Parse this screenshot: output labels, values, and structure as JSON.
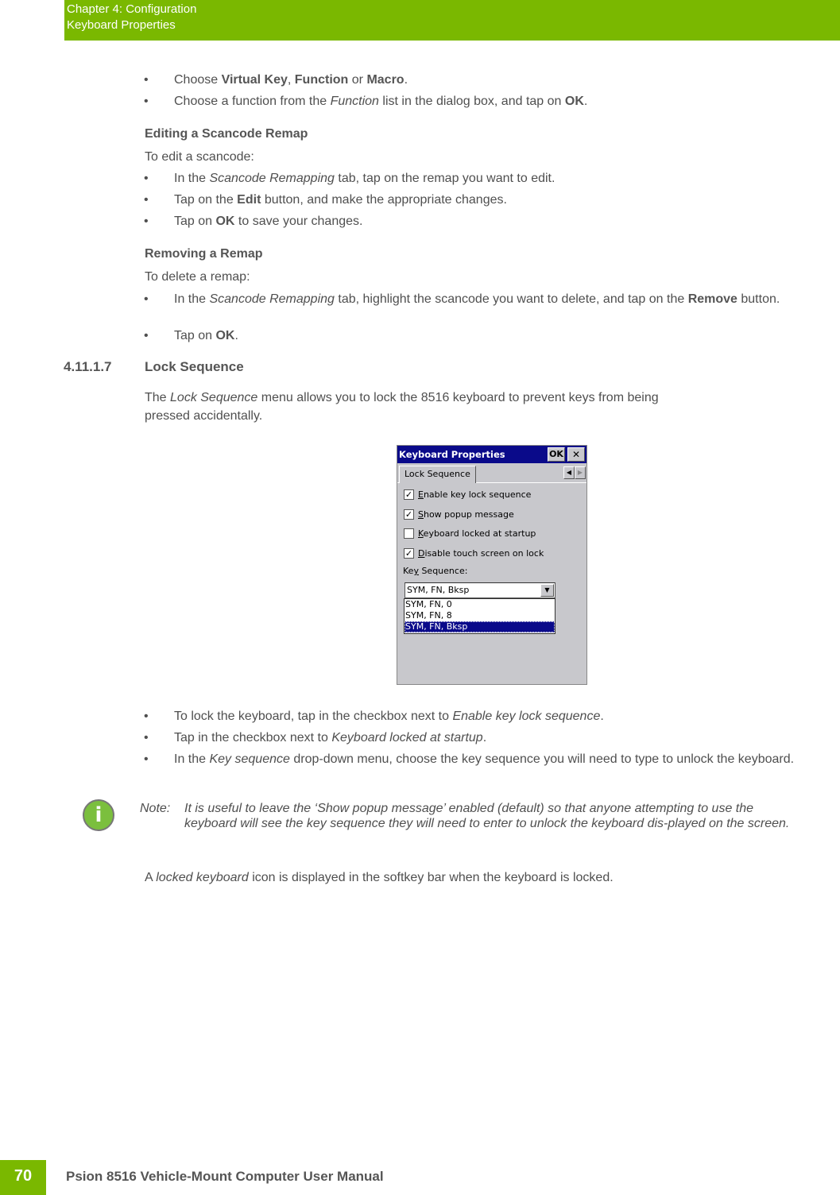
{
  "header": {
    "chapter": "Chapter 4:  Configuration",
    "section": "Keyboard Properties",
    "color": "#7ab800"
  },
  "top_bullets": [
    {
      "parts": [
        {
          "t": "Choose "
        },
        {
          "t": "Virtual Key",
          "b": true
        },
        {
          "t": ", "
        },
        {
          "t": "Function",
          "b": true
        },
        {
          "t": " or "
        },
        {
          "t": "Macro",
          "b": true
        },
        {
          "t": "."
        }
      ]
    },
    {
      "parts": [
        {
          "t": "Choose a function from the "
        },
        {
          "t": "Function",
          "i": true
        },
        {
          "t": " list in the dialog box, and tap on "
        },
        {
          "t": "OK",
          "b": true
        },
        {
          "t": "."
        }
      ]
    }
  ],
  "editing": {
    "heading": "Editing a Scancode Remap",
    "intro": "To edit a scancode:",
    "bullets": [
      {
        "parts": [
          {
            "t": "In the "
          },
          {
            "t": "Scancode Remapping",
            "i": true
          },
          {
            "t": " tab, tap on the remap you want to edit."
          }
        ]
      },
      {
        "parts": [
          {
            "t": "Tap on the "
          },
          {
            "t": "Edit",
            "b": true
          },
          {
            "t": " button, and make the appropriate changes."
          }
        ]
      },
      {
        "parts": [
          {
            "t": "Tap on "
          },
          {
            "t": "OK",
            "b": true
          },
          {
            "t": " to save your changes."
          }
        ]
      }
    ]
  },
  "removing": {
    "heading": "Removing a Remap",
    "intro": "To delete a remap:",
    "bullets": [
      {
        "parts": [
          {
            "t": "In the "
          },
          {
            "t": "Scancode Remapping",
            "i": true
          },
          {
            "t": " tab, highlight the scancode you want to delete, and tap on the "
          },
          {
            "t": "Remove",
            "b": true
          },
          {
            "t": " button."
          }
        ]
      },
      {
        "parts": [
          {
            "t": "Tap on "
          },
          {
            "t": "OK",
            "b": true
          },
          {
            "t": "."
          }
        ]
      }
    ]
  },
  "section": {
    "number": "4.11.1.7",
    "title": "Lock Sequence",
    "intro_parts": [
      {
        "t": "The "
      },
      {
        "t": "Lock Sequence",
        "i": true
      },
      {
        "t": " menu allows you to lock the 8516 keyboard to prevent keys from being"
      },
      {
        "br": true
      },
      {
        "t": "pressed accidentally."
      }
    ]
  },
  "dialog": {
    "title": "Keyboard Properties",
    "ok_label": "OK",
    "close_label": "✕",
    "tab_label": "Lock Sequence",
    "checkboxes": [
      {
        "accel": "E",
        "rest": "nable key lock sequence",
        "checked": true
      },
      {
        "accel": "S",
        "rest": "how popup message",
        "checked": true
      },
      {
        "accel": "K",
        "rest": "eyboard locked at startup",
        "checked": false
      },
      {
        "accel": "D",
        "rest": "isable touch screen on lock",
        "checked": true
      }
    ],
    "key_sequence_label_pre": "Ke",
    "key_sequence_label_accel": "y",
    "key_sequence_label_post": " Sequence:",
    "selected_value": "SYM, FN, Bksp",
    "options": [
      "SYM, FN, 0",
      "SYM, FN, 8",
      "SYM, FN, Bksp"
    ],
    "selected_index": 2
  },
  "lock_bullets": [
    {
      "parts": [
        {
          "t": "To lock the keyboard, tap in the checkbox next to "
        },
        {
          "t": "Enable key lock sequence",
          "i": true
        },
        {
          "t": "."
        }
      ]
    },
    {
      "parts": [
        {
          "t": "Tap in the checkbox next to "
        },
        {
          "t": "Keyboard locked at startup",
          "i": true
        },
        {
          "t": "."
        }
      ]
    },
    {
      "parts": [
        {
          "t": "In the "
        },
        {
          "t": "Key sequence",
          "i": true
        },
        {
          "t": " drop-down menu, choose the key sequence you will need to type to unlock the keyboard."
        }
      ]
    }
  ],
  "note": {
    "label": "Note:",
    "body": "It is useful to leave the ‘Show popup message’ enabled (default) so that anyone attempting to use the keyboard will see the key sequence they will need to enter to unlock the keyboard dis-played on the screen.",
    "icon": "info-icon"
  },
  "closing_parts": [
    {
      "t": "A "
    },
    {
      "t": "locked keyboard",
      "i": true
    },
    {
      "t": " icon is displayed in the softkey bar when the keyboard is locked."
    }
  ],
  "footer": {
    "page_number": "70",
    "title": "Psion 8516 Vehicle-Mount Computer User Manual"
  }
}
